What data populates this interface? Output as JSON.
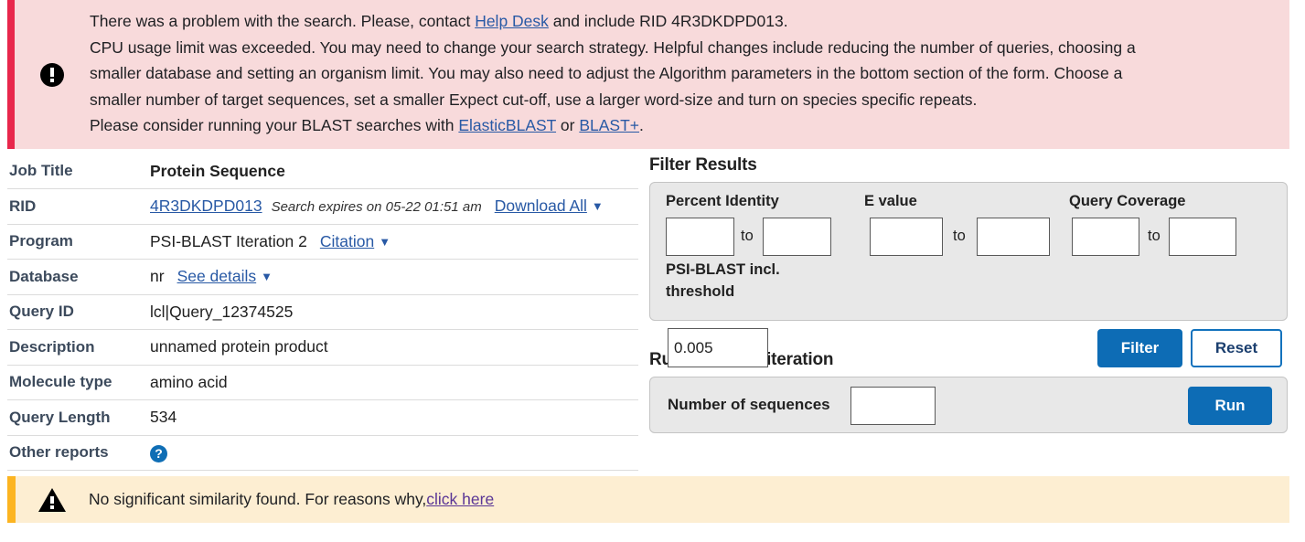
{
  "error_alert": {
    "icon": "error-circle-icon",
    "lines": [
      {
        "segments": [
          {
            "type": "text",
            "text": "There was a problem with the search. Please, contact "
          },
          {
            "type": "link",
            "text": "Help Desk"
          },
          {
            "type": "text",
            "text": " and include RID 4R3DKDPD013."
          }
        ]
      },
      {
        "segments": [
          {
            "type": "text",
            "text": "CPU usage limit was exceeded. You may need to change your search strategy. Helpful changes include reducing the number of queries, choosing a"
          }
        ]
      },
      {
        "segments": [
          {
            "type": "text",
            "text": "smaller database and setting an organism limit. You may also need to adjust the Algorithm parameters in the bottom section of the form. Choose a"
          }
        ]
      },
      {
        "segments": [
          {
            "type": "text",
            "text": "smaller number of target sequences, set a smaller Expect cut-off, use a larger word-size and turn on species specific repeats."
          }
        ]
      },
      {
        "segments": [
          {
            "type": "text",
            "text": "Please consider running your BLAST searches with "
          },
          {
            "type": "link",
            "text": "ElasticBLAST"
          },
          {
            "type": "text",
            "text": " or "
          },
          {
            "type": "link",
            "text": "BLAST+"
          },
          {
            "type": "text",
            "text": "."
          }
        ]
      }
    ],
    "line1_a": "There was a problem with the search. Please, contact ",
    "line1_link": "Help Desk",
    "line1_b": " and include RID 4R3DKDPD013.",
    "line2": "CPU usage limit was exceeded. You may need to change your search strategy. Helpful changes include reducing the number of queries, choosing a",
    "line3": "smaller database and setting an organism limit. You may also need to adjust the Algorithm parameters in the bottom section of the form. Choose a",
    "line4": "smaller number of target sequences, set a smaller Expect cut-off, use a larger word-size and turn on species specific repeats.",
    "line5_a": "Please consider running your BLAST searches with ",
    "line5_link1": "ElasticBLAST",
    "line5_mid": " or ",
    "line5_link2": "BLAST+",
    "line5_b": ".",
    "bar_color": "#e8274b",
    "bg_color": "#f8dadb"
  },
  "info": {
    "job_title_label": "Job Title",
    "job_title_value": "Protein Sequence",
    "rid_label": "RID",
    "rid_value": "4R3DKDPD013",
    "rid_expires": "Search expires on 05-22 01:51 am",
    "download_all": "Download All",
    "program_label": "Program",
    "program_value": "PSI-BLAST Iteration 2",
    "citation": "Citation",
    "database_label": "Database",
    "database_value": "nr",
    "see_details": "See details",
    "query_id_label": "Query ID",
    "query_id_value": "lcl|Query_12374525",
    "description_label": "Description",
    "description_value": "unnamed protein product",
    "molecule_type_label": "Molecule type",
    "molecule_type_value": "amino acid",
    "query_length_label": "Query Length",
    "query_length_value": "534",
    "other_reports_label": "Other reports",
    "other_reports_icon": "help-circle-icon",
    "chevron": "⌄"
  },
  "filter": {
    "title": "Filter Results",
    "percent_identity_label": "Percent Identity",
    "evalue_label": "E value",
    "query_coverage_label": "Query Coverage",
    "to_label": "to",
    "percent_identity_from": "",
    "percent_identity_to": "",
    "evalue_from": "",
    "evalue_to": "",
    "query_coverage_from": "",
    "query_coverage_to": "",
    "threshold_label_line1": "PSI-BLAST incl.",
    "threshold_label_line2": "threshold",
    "threshold_value": "0.005",
    "filter_button": "Filter",
    "reset_button": "Reset",
    "accent_color": "#0d6cb5"
  },
  "run_iteration": {
    "title": "Run PSI-Blast iteration",
    "num_sequences_label": "Number of sequences",
    "num_sequences_value": "",
    "run_button": "Run"
  },
  "warning_alert": {
    "icon": "warning-triangle-icon",
    "text_a": "No significant similarity found. For reasons why,",
    "link": "click here",
    "bar_color": "#fcb421",
    "bg_color": "#fdeed2"
  }
}
